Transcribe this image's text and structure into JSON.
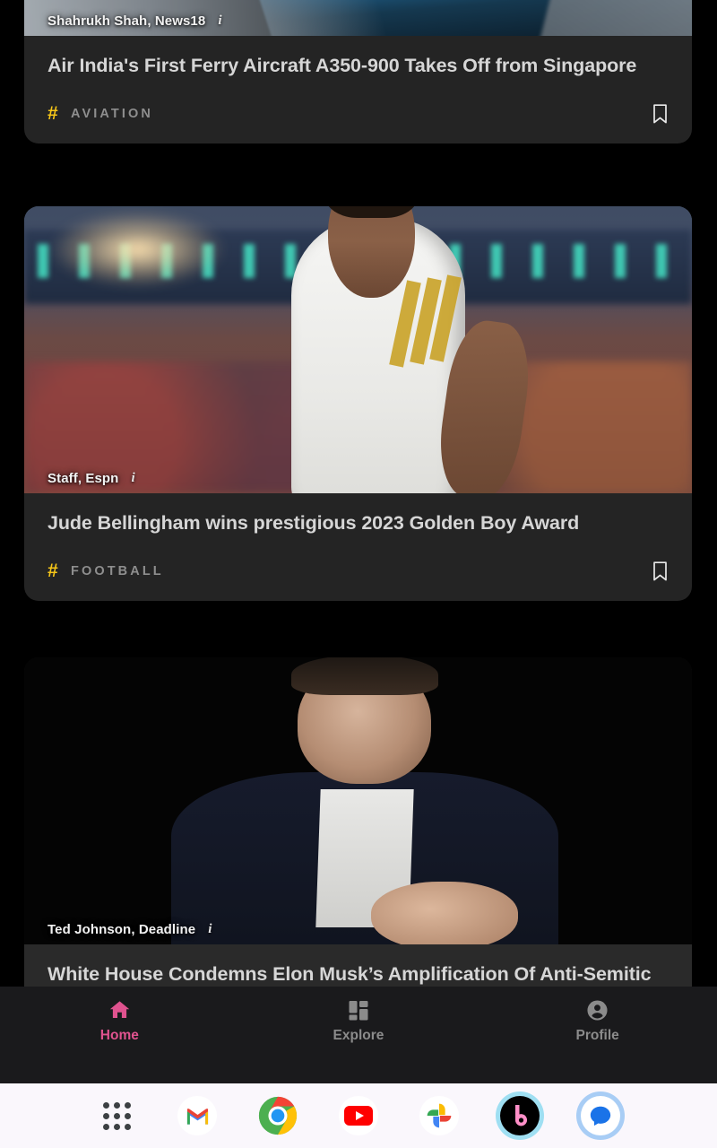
{
  "app": {
    "name": "news-feed"
  },
  "feed": {
    "cards": [
      {
        "byline": "Shahrukh Shah, News18",
        "info_glyph": "i",
        "title": "Air India's First Ferry Aircraft A350-900 Takes Off from Singapore",
        "hash_glyph": "#",
        "category": "AVIATION",
        "bookmark_icon": "bookmark-icon",
        "image_alt": "airplane-photo"
      },
      {
        "byline": "Staff, Espn",
        "info_glyph": "i",
        "title": "Jude Bellingham wins prestigious 2023 Golden Boy Award",
        "hash_glyph": "#",
        "category": "FOOTBALL",
        "bookmark_icon": "bookmark-icon",
        "image_alt": "footballer-photo"
      },
      {
        "byline": "Ted Johnson, Deadline",
        "info_glyph": "i",
        "title": "White House Condemns Elon Musk’s Amplification Of Anti-Semitic",
        "hash_glyph": "#",
        "category": "",
        "bookmark_icon": "bookmark-icon",
        "image_alt": "elon-musk-photo"
      }
    ]
  },
  "bottom_nav": {
    "items": [
      {
        "label": "Home",
        "icon": "home-icon",
        "active": true
      },
      {
        "label": "Explore",
        "icon": "grid-icon",
        "active": false
      },
      {
        "label": "Profile",
        "icon": "person-icon",
        "active": false
      }
    ],
    "active_color": "#e0538f",
    "inactive_color": "#8b8b8b"
  },
  "dock": {
    "items": [
      {
        "name": "all-apps-icon"
      },
      {
        "name": "gmail-icon"
      },
      {
        "name": "chrome-icon"
      },
      {
        "name": "youtube-icon"
      },
      {
        "name": "google-photos-icon"
      },
      {
        "name": "bixby-icon"
      },
      {
        "name": "messages-icon"
      }
    ]
  },
  "colors": {
    "page_background": "#000000",
    "card_background": "#242424",
    "hashtag": "#f5c518",
    "title_text": "#d6d6d6",
    "category_text": "#8e8e8e",
    "nav_background": "#1a1a1c",
    "dock_background": "#faf7fc"
  }
}
